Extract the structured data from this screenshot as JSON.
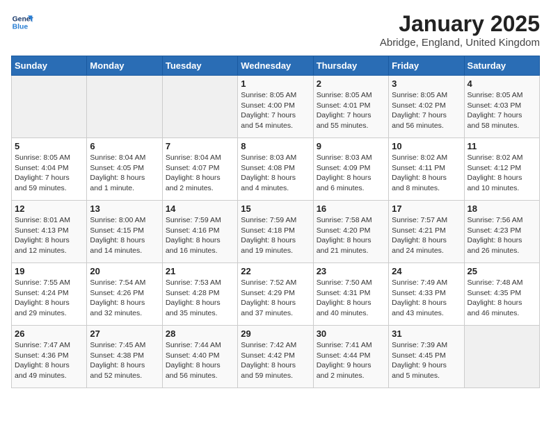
{
  "logo": {
    "line1": "General",
    "line2": "Blue"
  },
  "title": "January 2025",
  "subtitle": "Abridge, England, United Kingdom",
  "days_header": [
    "Sunday",
    "Monday",
    "Tuesday",
    "Wednesday",
    "Thursday",
    "Friday",
    "Saturday"
  ],
  "weeks": [
    [
      {
        "num": "",
        "info": ""
      },
      {
        "num": "",
        "info": ""
      },
      {
        "num": "",
        "info": ""
      },
      {
        "num": "1",
        "info": "Sunrise: 8:05 AM\nSunset: 4:00 PM\nDaylight: 7 hours\nand 54 minutes."
      },
      {
        "num": "2",
        "info": "Sunrise: 8:05 AM\nSunset: 4:01 PM\nDaylight: 7 hours\nand 55 minutes."
      },
      {
        "num": "3",
        "info": "Sunrise: 8:05 AM\nSunset: 4:02 PM\nDaylight: 7 hours\nand 56 minutes."
      },
      {
        "num": "4",
        "info": "Sunrise: 8:05 AM\nSunset: 4:03 PM\nDaylight: 7 hours\nand 58 minutes."
      }
    ],
    [
      {
        "num": "5",
        "info": "Sunrise: 8:05 AM\nSunset: 4:04 PM\nDaylight: 7 hours\nand 59 minutes."
      },
      {
        "num": "6",
        "info": "Sunrise: 8:04 AM\nSunset: 4:05 PM\nDaylight: 8 hours\nand 1 minute."
      },
      {
        "num": "7",
        "info": "Sunrise: 8:04 AM\nSunset: 4:07 PM\nDaylight: 8 hours\nand 2 minutes."
      },
      {
        "num": "8",
        "info": "Sunrise: 8:03 AM\nSunset: 4:08 PM\nDaylight: 8 hours\nand 4 minutes."
      },
      {
        "num": "9",
        "info": "Sunrise: 8:03 AM\nSunset: 4:09 PM\nDaylight: 8 hours\nand 6 minutes."
      },
      {
        "num": "10",
        "info": "Sunrise: 8:02 AM\nSunset: 4:11 PM\nDaylight: 8 hours\nand 8 minutes."
      },
      {
        "num": "11",
        "info": "Sunrise: 8:02 AM\nSunset: 4:12 PM\nDaylight: 8 hours\nand 10 minutes."
      }
    ],
    [
      {
        "num": "12",
        "info": "Sunrise: 8:01 AM\nSunset: 4:13 PM\nDaylight: 8 hours\nand 12 minutes."
      },
      {
        "num": "13",
        "info": "Sunrise: 8:00 AM\nSunset: 4:15 PM\nDaylight: 8 hours\nand 14 minutes."
      },
      {
        "num": "14",
        "info": "Sunrise: 7:59 AM\nSunset: 4:16 PM\nDaylight: 8 hours\nand 16 minutes."
      },
      {
        "num": "15",
        "info": "Sunrise: 7:59 AM\nSunset: 4:18 PM\nDaylight: 8 hours\nand 19 minutes."
      },
      {
        "num": "16",
        "info": "Sunrise: 7:58 AM\nSunset: 4:20 PM\nDaylight: 8 hours\nand 21 minutes."
      },
      {
        "num": "17",
        "info": "Sunrise: 7:57 AM\nSunset: 4:21 PM\nDaylight: 8 hours\nand 24 minutes."
      },
      {
        "num": "18",
        "info": "Sunrise: 7:56 AM\nSunset: 4:23 PM\nDaylight: 8 hours\nand 26 minutes."
      }
    ],
    [
      {
        "num": "19",
        "info": "Sunrise: 7:55 AM\nSunset: 4:24 PM\nDaylight: 8 hours\nand 29 minutes."
      },
      {
        "num": "20",
        "info": "Sunrise: 7:54 AM\nSunset: 4:26 PM\nDaylight: 8 hours\nand 32 minutes."
      },
      {
        "num": "21",
        "info": "Sunrise: 7:53 AM\nSunset: 4:28 PM\nDaylight: 8 hours\nand 35 minutes."
      },
      {
        "num": "22",
        "info": "Sunrise: 7:52 AM\nSunset: 4:29 PM\nDaylight: 8 hours\nand 37 minutes."
      },
      {
        "num": "23",
        "info": "Sunrise: 7:50 AM\nSunset: 4:31 PM\nDaylight: 8 hours\nand 40 minutes."
      },
      {
        "num": "24",
        "info": "Sunrise: 7:49 AM\nSunset: 4:33 PM\nDaylight: 8 hours\nand 43 minutes."
      },
      {
        "num": "25",
        "info": "Sunrise: 7:48 AM\nSunset: 4:35 PM\nDaylight: 8 hours\nand 46 minutes."
      }
    ],
    [
      {
        "num": "26",
        "info": "Sunrise: 7:47 AM\nSunset: 4:36 PM\nDaylight: 8 hours\nand 49 minutes."
      },
      {
        "num": "27",
        "info": "Sunrise: 7:45 AM\nSunset: 4:38 PM\nDaylight: 8 hours\nand 52 minutes."
      },
      {
        "num": "28",
        "info": "Sunrise: 7:44 AM\nSunset: 4:40 PM\nDaylight: 8 hours\nand 56 minutes."
      },
      {
        "num": "29",
        "info": "Sunrise: 7:42 AM\nSunset: 4:42 PM\nDaylight: 8 hours\nand 59 minutes."
      },
      {
        "num": "30",
        "info": "Sunrise: 7:41 AM\nSunset: 4:44 PM\nDaylight: 9 hours\nand 2 minutes."
      },
      {
        "num": "31",
        "info": "Sunrise: 7:39 AM\nSunset: 4:45 PM\nDaylight: 9 hours\nand 5 minutes."
      },
      {
        "num": "",
        "info": ""
      }
    ]
  ]
}
